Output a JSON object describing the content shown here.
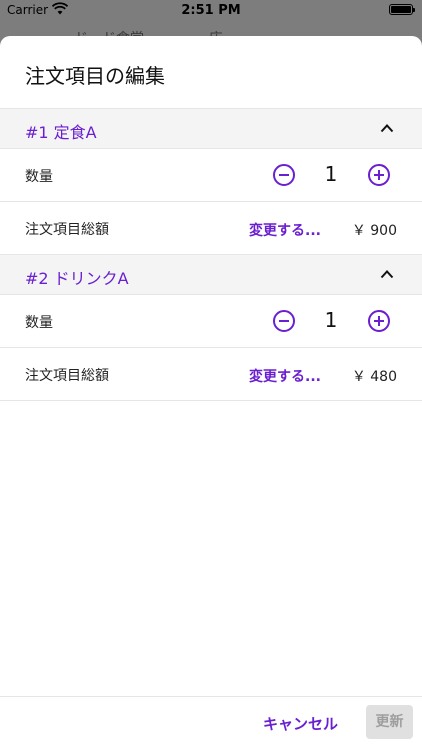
{
  "status_bar": {
    "carrier": "Carrier",
    "time": "2:51 PM"
  },
  "background": {
    "title_fragment": "…ド…ド食堂… …… …店"
  },
  "dialog": {
    "title": "注文項目の編集",
    "items": [
      {
        "header": "#1 定食A",
        "quantity_label": "数量",
        "quantity": "1",
        "total_label": "注文項目総額",
        "change_label": "変更する...",
        "price": "￥ 900"
      },
      {
        "header": "#2 ドリンクA",
        "quantity_label": "数量",
        "quantity": "1",
        "total_label": "注文項目総額",
        "change_label": "変更する...",
        "price": "￥ 480"
      }
    ],
    "cancel_label": "キャンセル",
    "update_label": "更新"
  },
  "colors": {
    "accent": "#6a1fd0",
    "disabled_bg": "#e0e0e0",
    "disabled_text": "#9e9e9e"
  },
  "icons": {
    "collapse": "chevron-up-icon",
    "decrement": "minus-circle-icon",
    "increment": "plus-circle-icon"
  }
}
